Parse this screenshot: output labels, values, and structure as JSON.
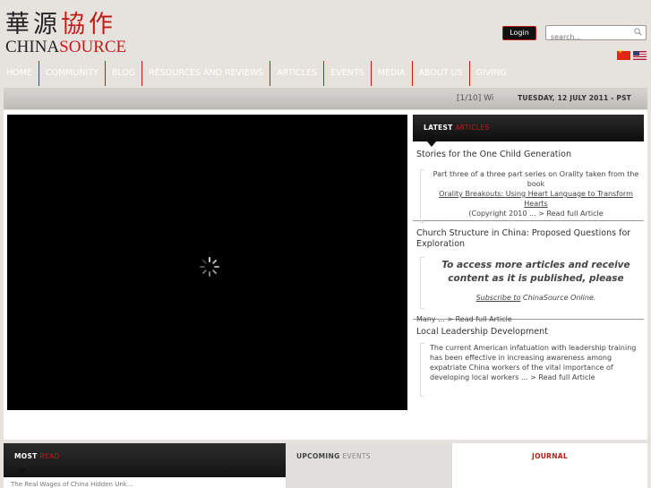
{
  "header": {
    "logo_cn_black": "華源",
    "logo_cn_red": "協作",
    "logo_en_black": "CHINA",
    "logo_en_red": "SOURCE",
    "login_label": "Login",
    "search_placeholder": "search..."
  },
  "nav": {
    "items": [
      "Home",
      "Community",
      "Blog",
      "Resources and Reviews",
      "Articles",
      "Events",
      "Media",
      "About Us",
      "Giving"
    ]
  },
  "ticker": {
    "text": "[1/10] Wi",
    "date": "TUESDAY, 12 JULY 2011 - PST"
  },
  "latest": {
    "title_main": "LATEST",
    "title_accent": "ARTICLES",
    "articles": [
      {
        "title": "Stories for the One Child Generation",
        "excerpt_pre": "Part three of a three part series on Orality taken from the book",
        "book": "Orality Breakouts: Using Heart Language to Transform Hearts",
        "excerpt_post": "(Copyright 2010 ... > Read full Article"
      },
      {
        "title": "Church Structure in China: Proposed Questions for Exploration",
        "note": "To access more articles and receive content as it is published, please",
        "subscribe_link": "Subscribe to",
        "subscribe_text": " ChinaSource Online",
        "subscribe_end": ".",
        "many": "Many ... > Read full Article"
      },
      {
        "title": "Local Leadership Development",
        "excerpt": "The current American infatuation with leadership training has been effective in increasing awareness among expatriate China workers of the vital importance of developing local workers ... > Read full Article"
      }
    ]
  },
  "bottom": {
    "most_read_main": "MOST",
    "most_read_accent": "READ",
    "most_read_peek": "The Real Wages of China Hidden Unk...",
    "upcoming_main": "UPCOMING",
    "upcoming_accent": "EVENTS",
    "journal": "JOURNAL"
  },
  "colors": {
    "brand_red": "#c21b17",
    "page_bg": "#e6e3df"
  }
}
